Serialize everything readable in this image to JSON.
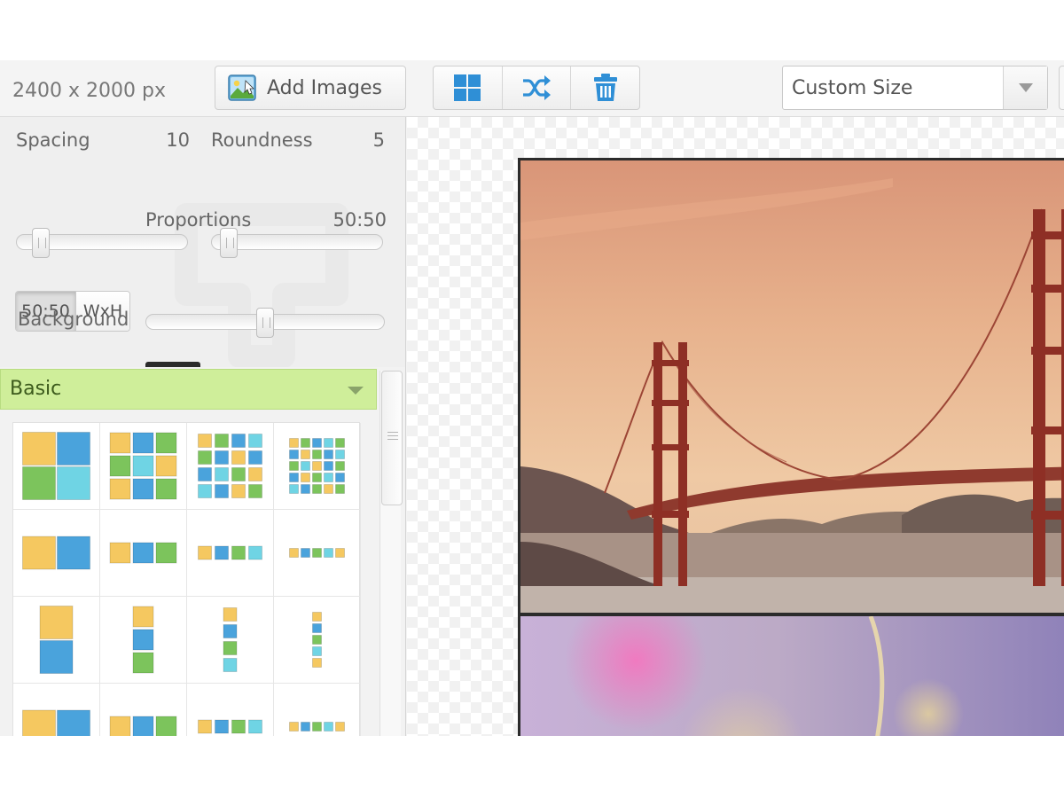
{
  "toolbar": {
    "canvas_size": "2400 x 2000 px",
    "add_images_label": "Add Images",
    "actions": [
      {
        "icon": "grid-layout-icon"
      },
      {
        "icon": "shuffle-icon"
      },
      {
        "icon": "trash-icon"
      }
    ],
    "size_select": {
      "selected": "Custom Size"
    }
  },
  "settings": {
    "spacing": {
      "label": "Spacing",
      "value": "10",
      "level": 10
    },
    "roundness": {
      "label": "Roundness",
      "value": "5",
      "level": 5
    },
    "proportions": {
      "label": "Proportions",
      "value": "50:50",
      "level": 50
    },
    "ratio_toggle": {
      "options": [
        "50:50",
        "WxH"
      ],
      "selected": "50:50"
    },
    "background": {
      "label": "Background",
      "color": "#2b2b2b"
    }
  },
  "layouts": {
    "category": "Basic",
    "accent_color": "#cfee9a",
    "tile_colors": [
      "#f5c860",
      "#4aa3dc",
      "#7cc45c",
      "#6fd4e4"
    ]
  },
  "canvas": {
    "photos": [
      {
        "subject": "golden-gate-bridge-sunset"
      },
      {
        "subject": "bokeh-lights"
      }
    ]
  }
}
